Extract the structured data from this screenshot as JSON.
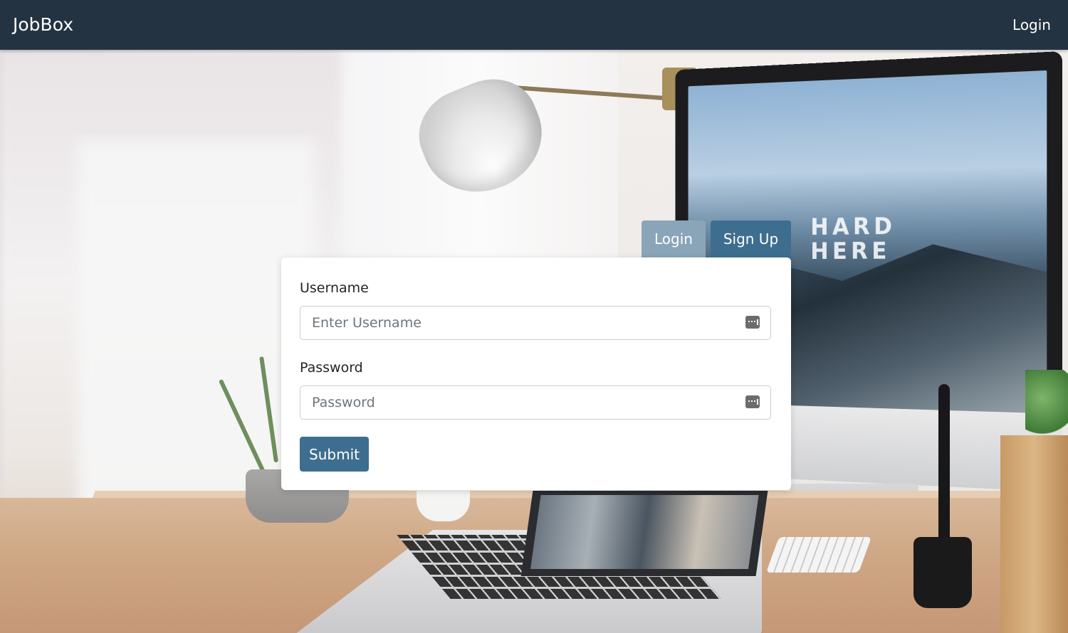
{
  "navbar": {
    "brand": "JobBox",
    "login_link": "Login",
    "background_color": "#243342"
  },
  "tabs": [
    {
      "label": "Login",
      "color": "#8aa5b8"
    },
    {
      "label": "Sign Up",
      "color": "#3e6e8f",
      "active": true
    }
  ],
  "form": {
    "username_label": "Username",
    "username_placeholder": "Enter Username",
    "username_value": "",
    "password_label": "Password",
    "password_placeholder": "Password",
    "password_value": "",
    "submit_label": "Submit",
    "field_icon": "password-manager-key-icon",
    "accent_color": "#3e6e8f"
  },
  "background": {
    "monitor_text": [
      "HARD",
      "HERE"
    ]
  }
}
